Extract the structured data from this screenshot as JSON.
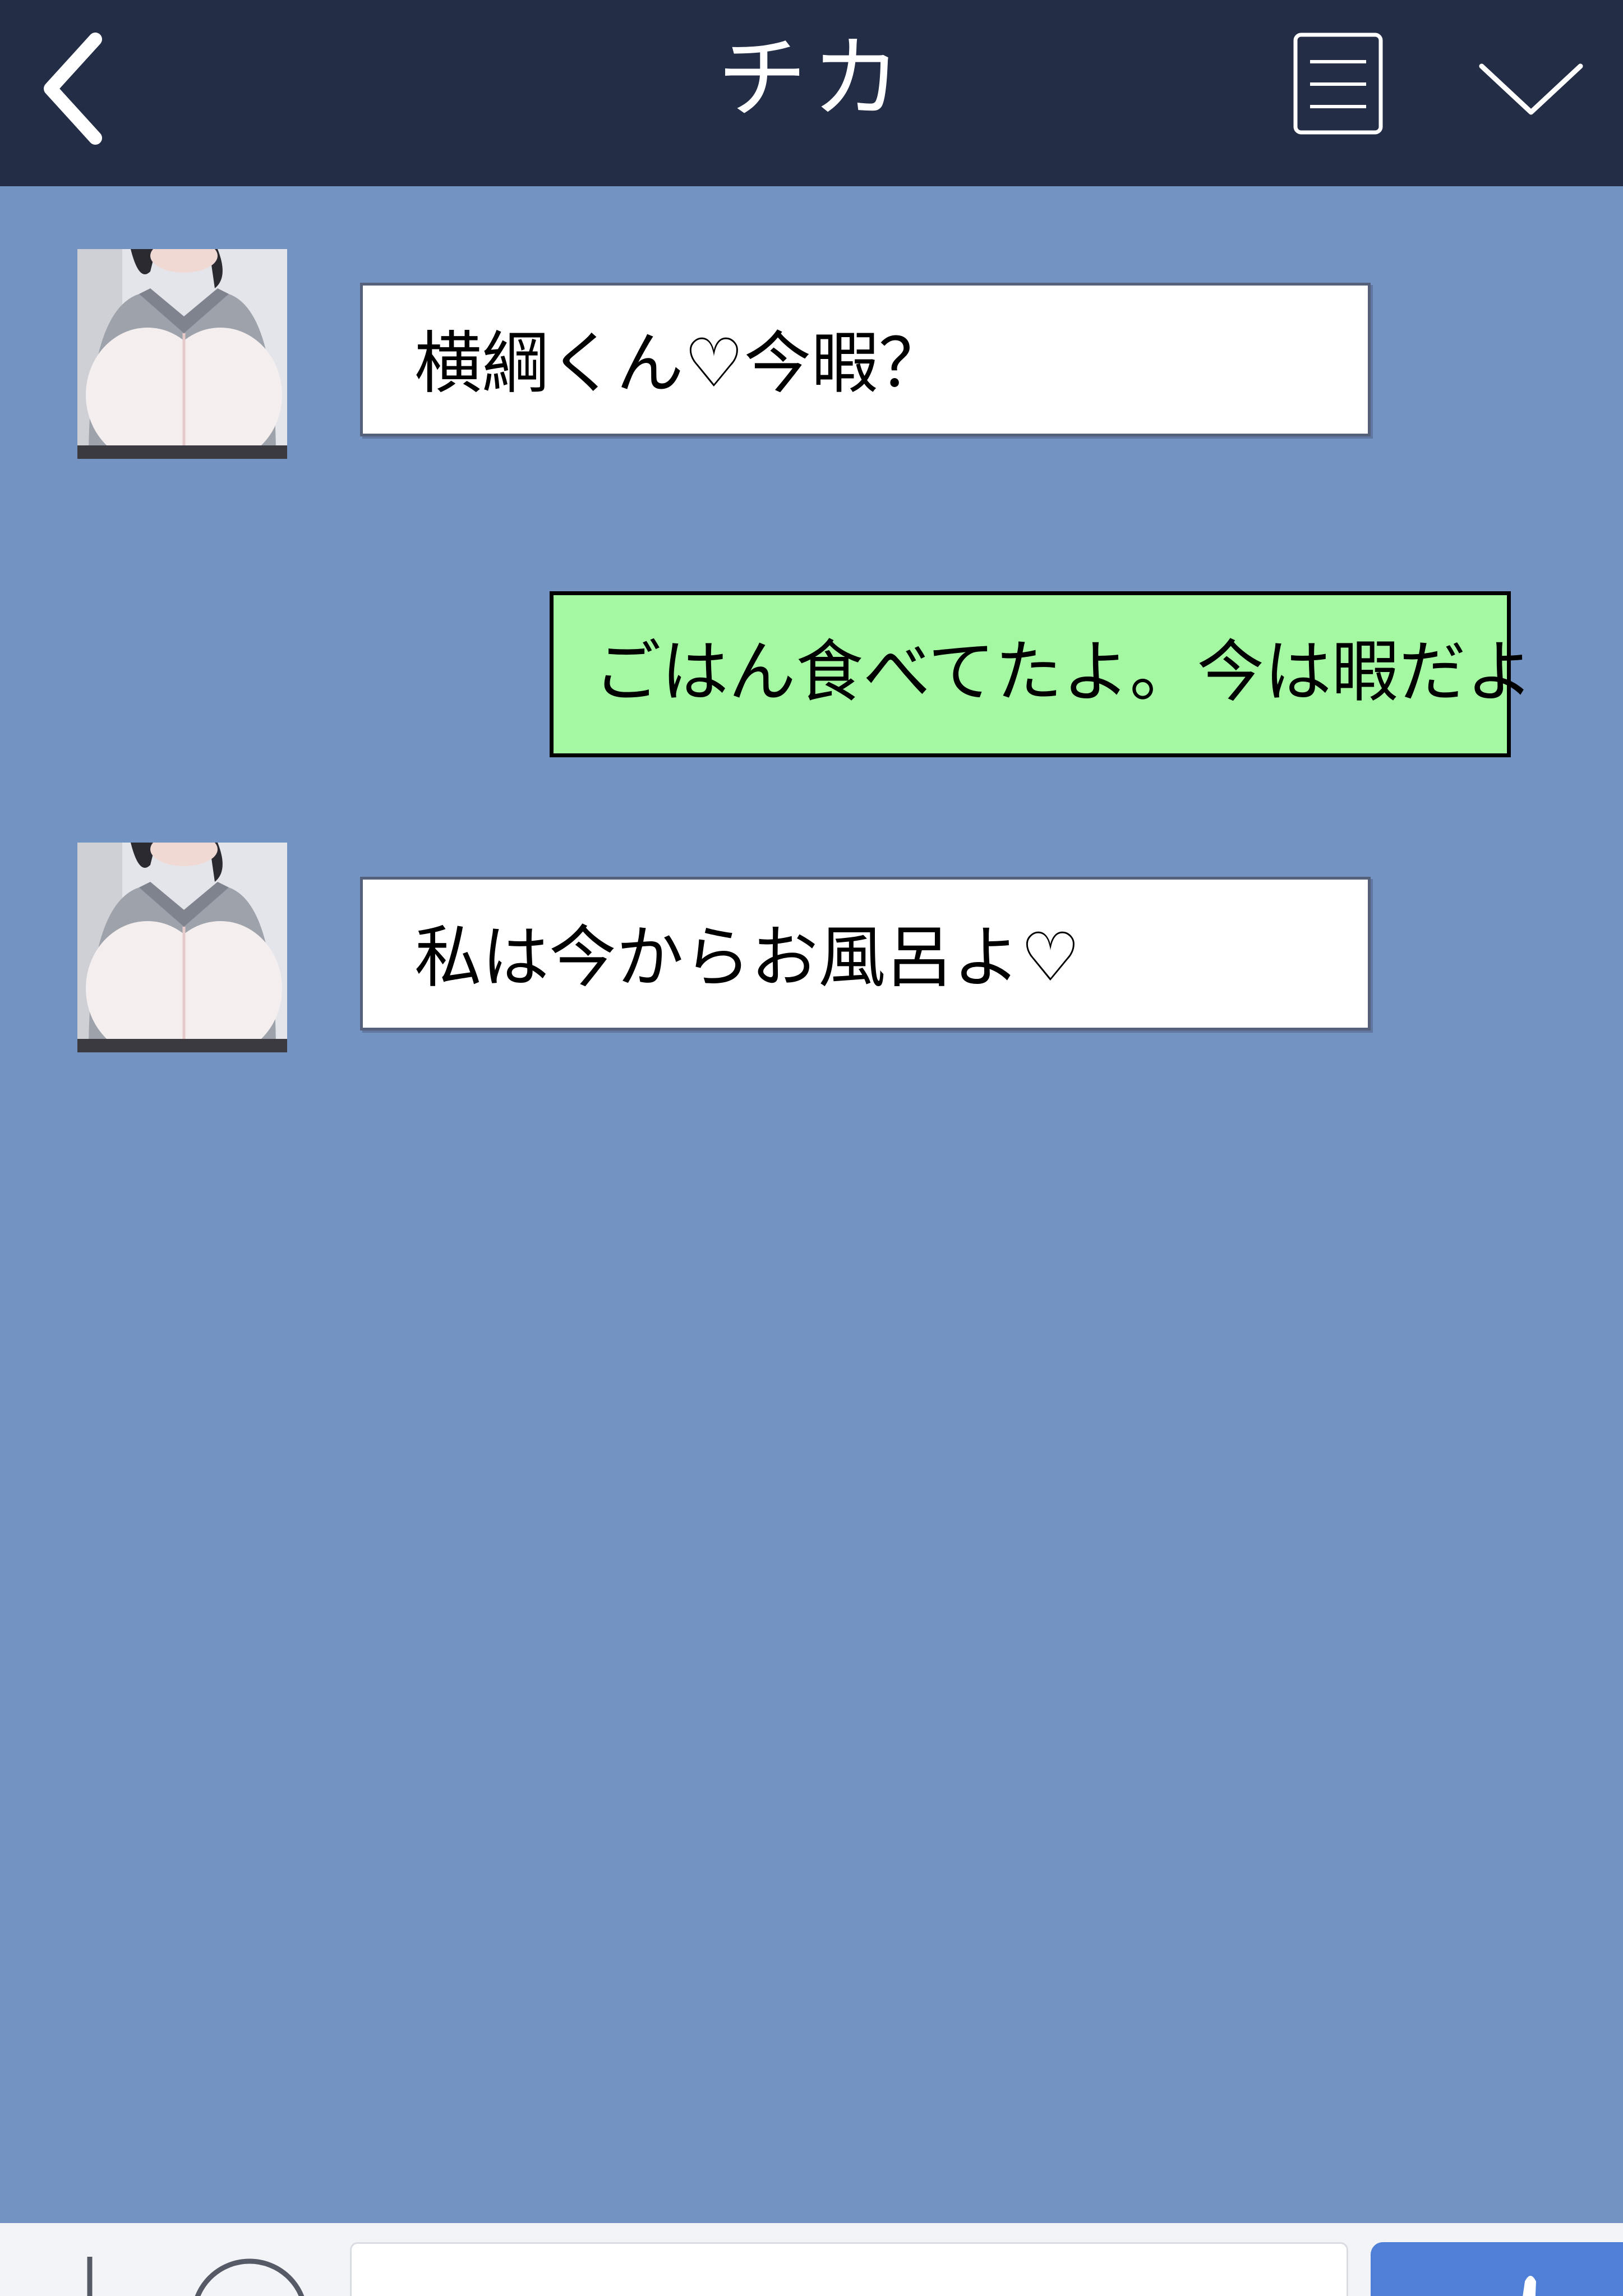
{
  "header": {
    "title": "チカ",
    "back_icon": "chevron-left-icon",
    "menu_icon": "document-menu-icon",
    "collapse_icon": "chevron-down-icon"
  },
  "messages": [
    {
      "sender": "incoming",
      "text": "横綱くん♡今暇？"
    },
    {
      "sender": "outgoing",
      "text": "ごはん食べてたよ。今は暇だよ"
    },
    {
      "sender": "incoming",
      "text": "私は今からお風呂よ♡"
    }
  ],
  "input_bar": {
    "plus_icon": "plus-icon",
    "emoji_icon": "emoji-icon",
    "message_value": "",
    "send_icon": "send-icon"
  },
  "colors": {
    "header_bg": "#232d45",
    "chat_bg": "#7393c2",
    "incoming_bubble": "#ffffff",
    "outgoing_bubble": "#a4f8a2",
    "send_button": "#4f7fd6"
  }
}
